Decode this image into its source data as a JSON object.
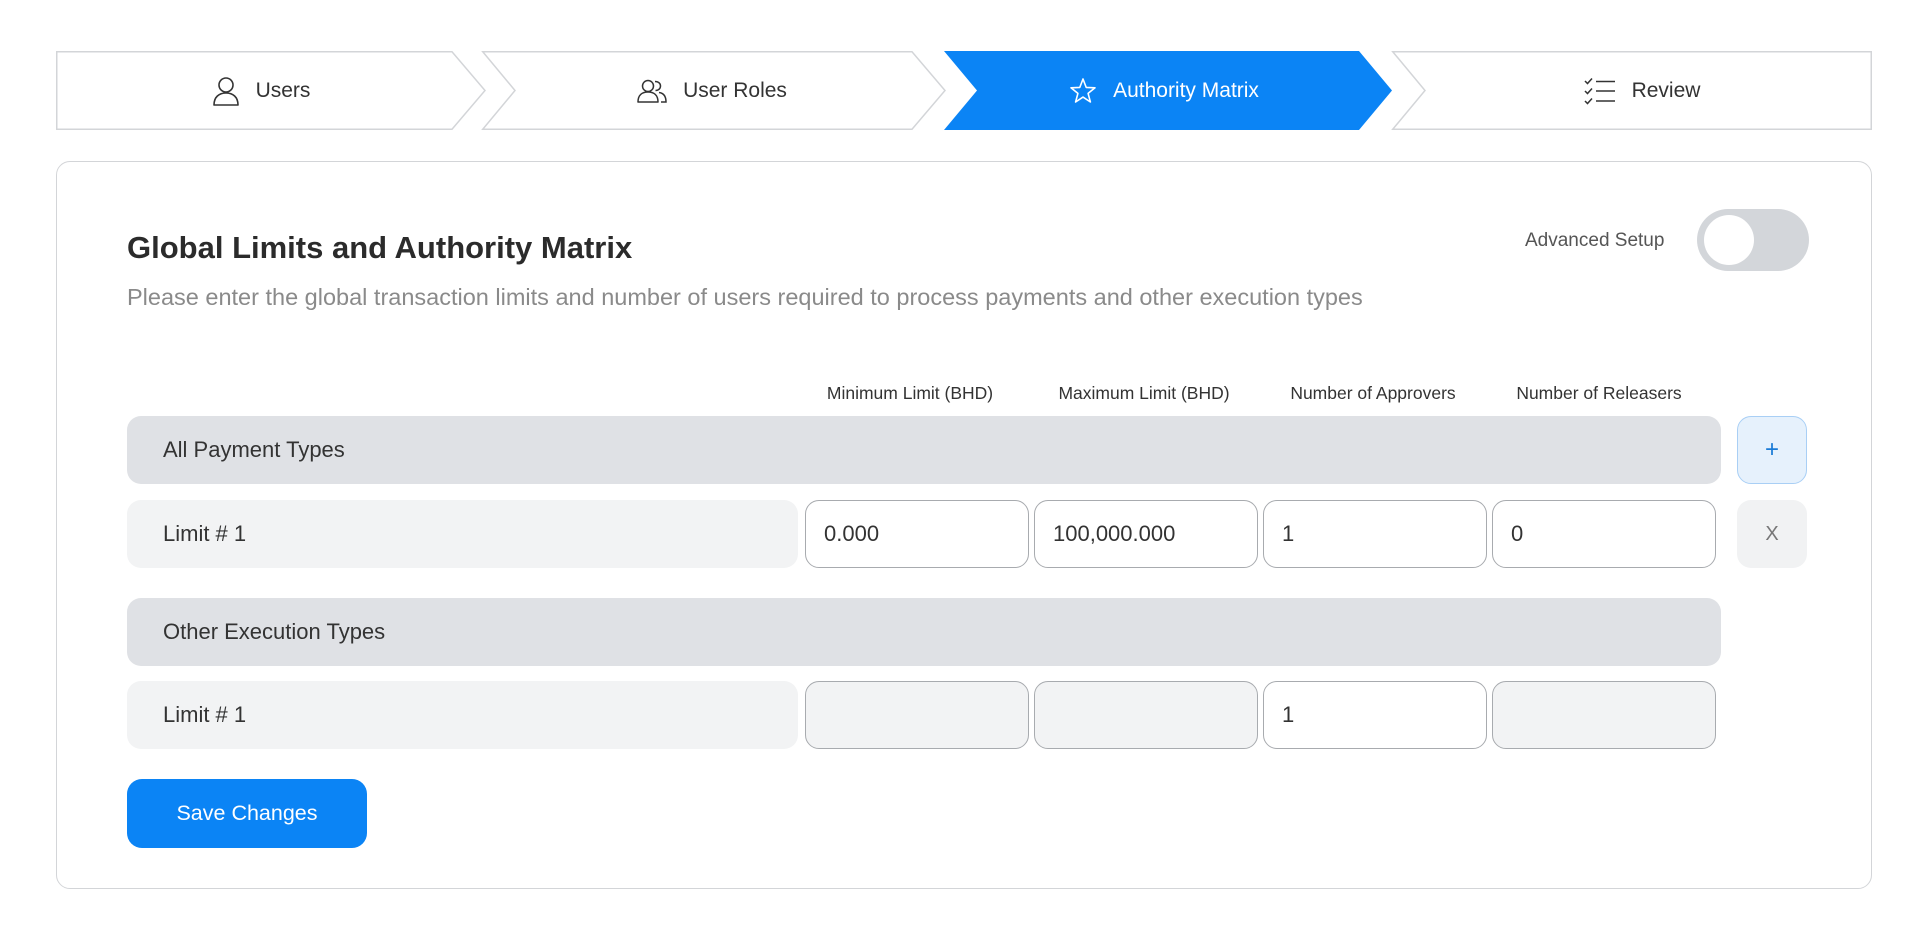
{
  "stepper": {
    "steps": [
      {
        "label": "Users",
        "icon": "user-icon",
        "state": "inactive"
      },
      {
        "label": "User Roles",
        "icon": "users-icon",
        "state": "inactive"
      },
      {
        "label": "Authority Matrix",
        "icon": "star-icon",
        "state": "active"
      },
      {
        "label": "Review",
        "icon": "checklist-icon",
        "state": "inactive"
      }
    ],
    "active_color": "#0b84f5"
  },
  "header": {
    "title": "Global Limits and Authority Matrix",
    "subtitle": "Please enter the global transaction limits and number of users required to process payments and other execution types",
    "advanced_setup_label": "Advanced Setup",
    "advanced_setup_enabled": false
  },
  "columns": [
    "Minimum Limit (BHD)",
    "Maximum Limit (BHD)",
    "Number of Approvers",
    "Number of Releasers"
  ],
  "groups": [
    {
      "name": "All Payment Types",
      "add_label": "+",
      "rows": [
        {
          "label": "Limit # 1",
          "min": "0.000",
          "max": "100,000.000",
          "approvers": "1",
          "releasers": "0",
          "remove_label": "X"
        }
      ]
    },
    {
      "name": "Other Execution Types",
      "rows": [
        {
          "label": "Limit # 1",
          "min": "",
          "max": "",
          "approvers": "1",
          "releasers": ""
        }
      ]
    }
  ],
  "actions": {
    "save_label": "Save Changes"
  },
  "colors": {
    "primary": "#0b84f5",
    "group_bg": "#dfe1e5",
    "row_bg": "#f2f3f4"
  }
}
